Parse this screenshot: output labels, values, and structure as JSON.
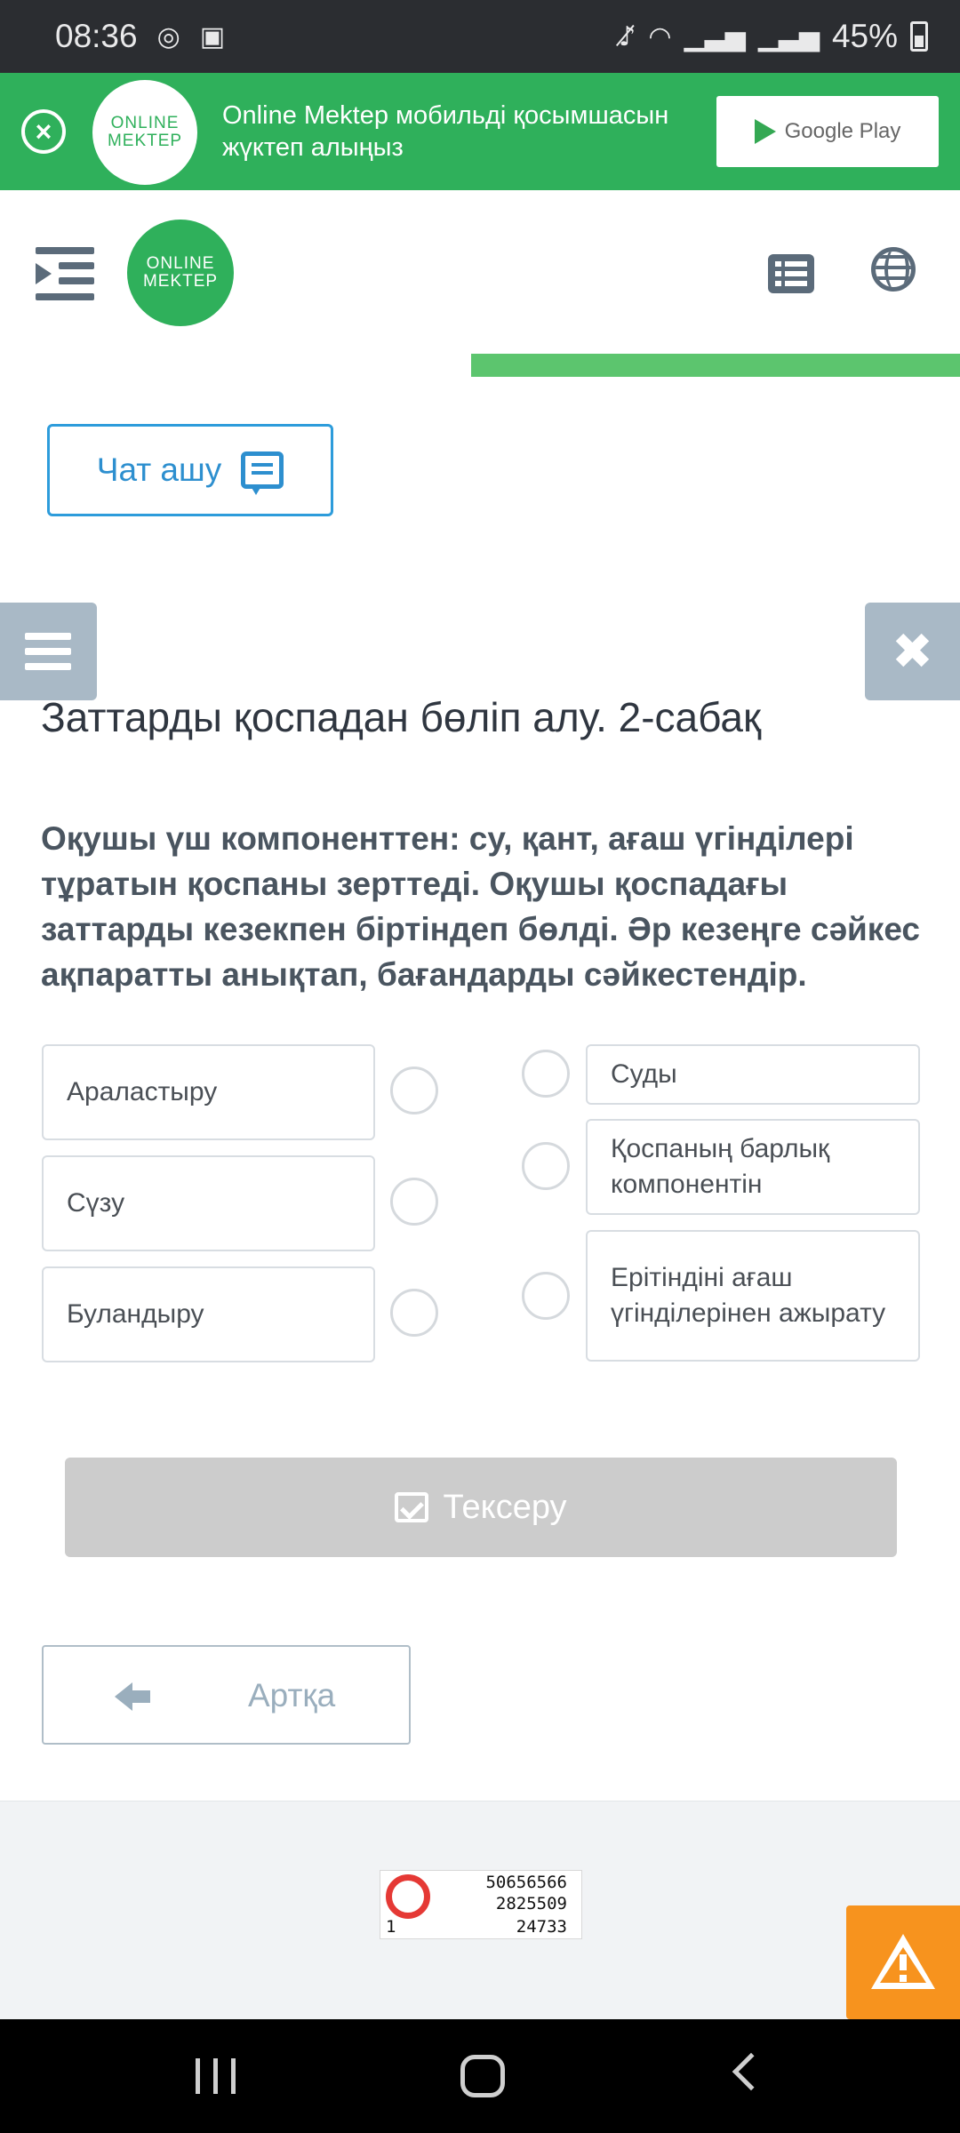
{
  "status_bar": {
    "time": "08:36",
    "battery": "45%",
    "icons": [
      "whatsapp-icon",
      "screen-record-icon",
      "mute-icon",
      "wifi-icon",
      "signal-icon",
      "signal-icon",
      "battery-icon"
    ]
  },
  "promo_banner": {
    "logo_line1": "ONLINE",
    "logo_line2": "MEKTEP",
    "text": "Online Mektep мобильді қосымшасын жүктеп алыңыз",
    "store_button": "Google Play"
  },
  "header": {
    "logo_line1": "ONLINE",
    "logo_line2": "MEKTEP"
  },
  "progress": {
    "value": 0.51
  },
  "chat_button": {
    "label": "Чат ашу"
  },
  "lesson": {
    "title": "Заттарды қоспадан бөліп алу. 2-сабақ",
    "question": "Оқушы үш компоненттен: су, қант, ағаш үгінділері тұратын қоспаны зерттеді. Оқушы қоспадағы заттарды кезекпен біртіндеп бөлді. Әр кезеңге сәйкес ақпаратты анықтап, бағандарды сәйкестендір."
  },
  "matching": {
    "left": [
      "Араластыру",
      "Сүзу",
      "Буландыру"
    ],
    "right": [
      "Суды",
      "Қоспаның барлық компонентін",
      "Ерітіндіні ағаш үгінділерінен ажырату"
    ]
  },
  "check_button": {
    "label": "Тексеру"
  },
  "back_button": {
    "label": "Артқа"
  },
  "counter": {
    "line1": "50656566",
    "line2": "2825509",
    "line3": "24733",
    "line_left": "1"
  },
  "colors": {
    "brand_green": "#2fb05b",
    "accent_blue": "#2d8fcf",
    "warning_orange": "#f7931e",
    "disabled_gray": "#cccccc"
  }
}
